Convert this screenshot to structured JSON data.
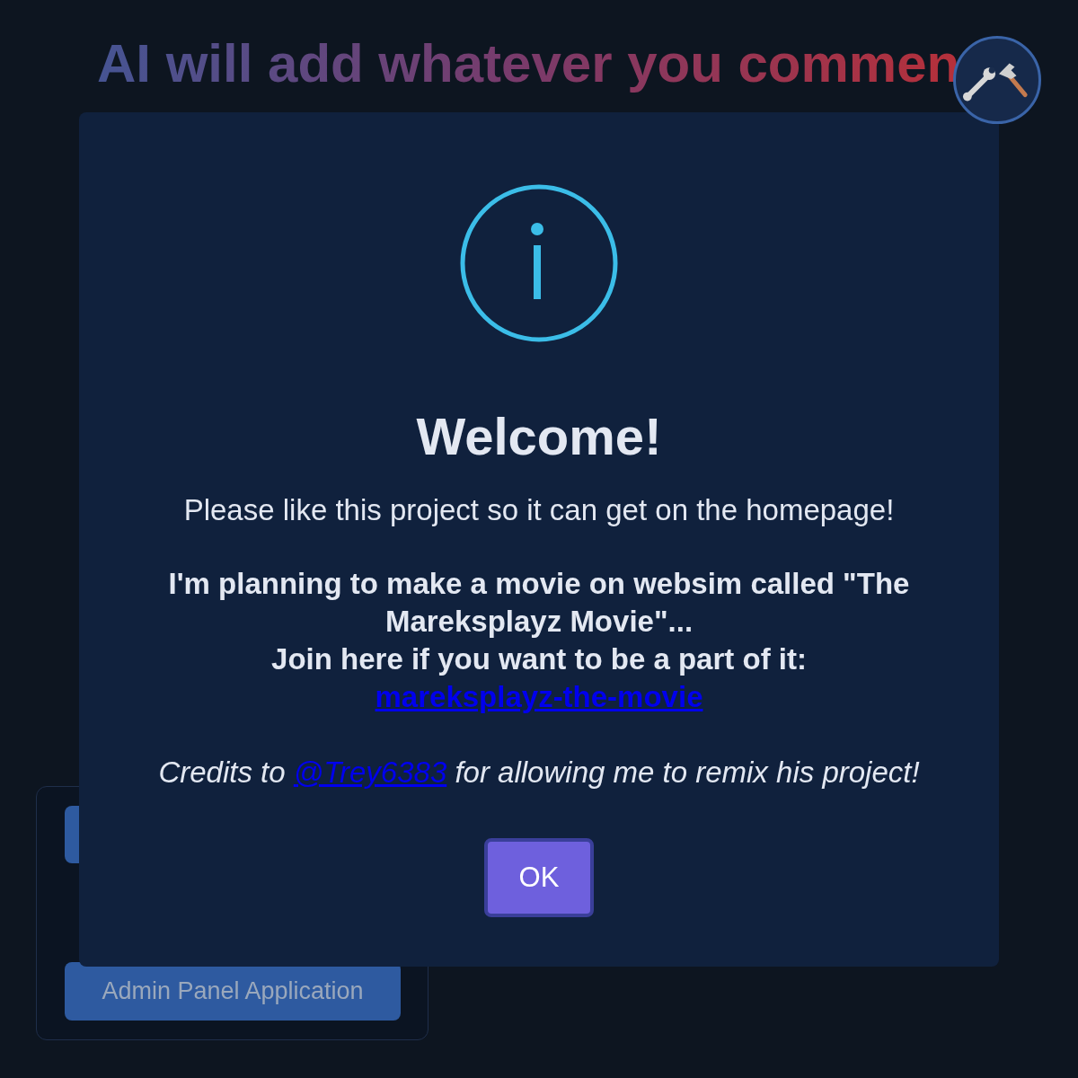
{
  "heading": "AI will add whatever you commen",
  "panel": {
    "buttons": [
      "Admin Panel Application"
    ]
  },
  "dialog": {
    "title": "Welcome!",
    "message": "Please like this project so it can get on the homepage!",
    "notice": {
      "lines": [
        "I'm planning to make a movie on websim called \"The Mareksplayz Movie\"...",
        "Join here if you want to be a part of it:"
      ],
      "link": "mareksplayz-the-movie"
    },
    "credits": {
      "before": "Credits to",
      "link": "@Trey6383",
      "after": "for allowing me to remix his project!"
    },
    "button": "OK"
  }
}
